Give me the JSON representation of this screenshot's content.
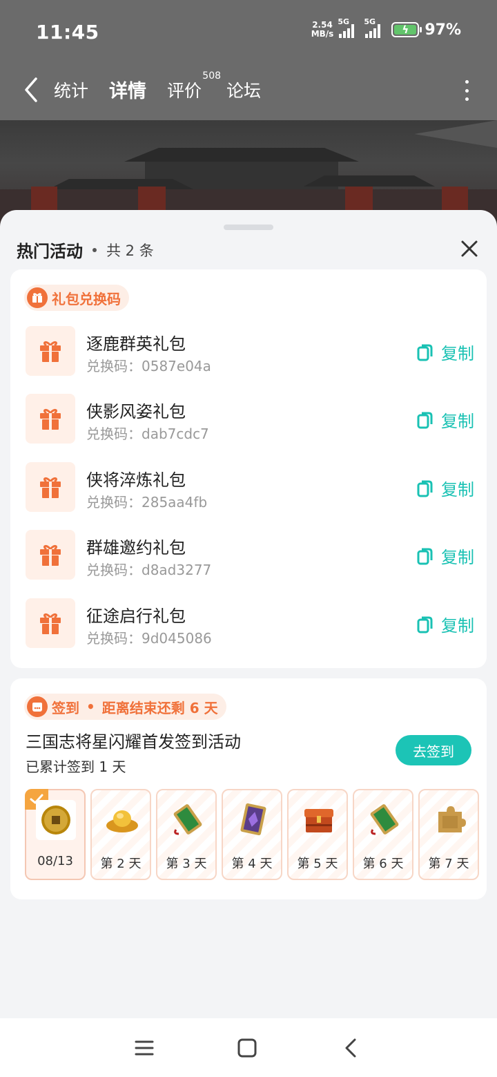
{
  "status_bar": {
    "time": "11:45",
    "speed_value": "2.54",
    "speed_unit": "MB/s",
    "net1": "5G",
    "net2": "5G",
    "battery": "97%"
  },
  "nav": {
    "tabs": [
      {
        "label": "统计"
      },
      {
        "label": "详情"
      },
      {
        "label": "评价"
      },
      {
        "label": "论坛"
      }
    ],
    "review_count": "508",
    "active_tab": "详情"
  },
  "sheet": {
    "title": "热门活动",
    "count_text": "共 2 条"
  },
  "gift_section": {
    "tag": "礼包兑换码",
    "copy_label": "复制",
    "code_prefix": "兑换码：",
    "items": [
      {
        "name": "逐鹿群英礼包",
        "code": "0587e04a"
      },
      {
        "name": "侠影风姿礼包",
        "code": "dab7cdc7"
      },
      {
        "name": "侠将淬炼礼包",
        "code": "285aa4fb"
      },
      {
        "name": "群雄邀约礼包",
        "code": "d8ad3277"
      },
      {
        "name": "征途启行礼包",
        "code": "9d045086"
      }
    ]
  },
  "signin_section": {
    "tag": "签到",
    "remaining": "距离结束还剩 6 天",
    "title": "三国志将星闪耀首发签到活动",
    "progress": "已累计签到 1 天",
    "button": "去签到",
    "days": [
      {
        "label": "08/13",
        "reward": "coin-icon",
        "done": true
      },
      {
        "label": "第 2 天",
        "reward": "gold-ingot-icon",
        "done": false
      },
      {
        "label": "第 3 天",
        "reward": "jade-token-icon",
        "done": false
      },
      {
        "label": "第 4 天",
        "reward": "purple-card-icon",
        "done": false
      },
      {
        "label": "第 5 天",
        "reward": "treasure-chest-icon",
        "done": false
      },
      {
        "label": "第 6 天",
        "reward": "jade-token-icon",
        "done": false
      },
      {
        "label": "第 7 天",
        "reward": "puzzle-piece-icon",
        "done": false
      }
    ]
  },
  "colors": {
    "accent": "#1cc4b6",
    "orange": "#f0713a",
    "tab_underline": "#0f7a76"
  }
}
